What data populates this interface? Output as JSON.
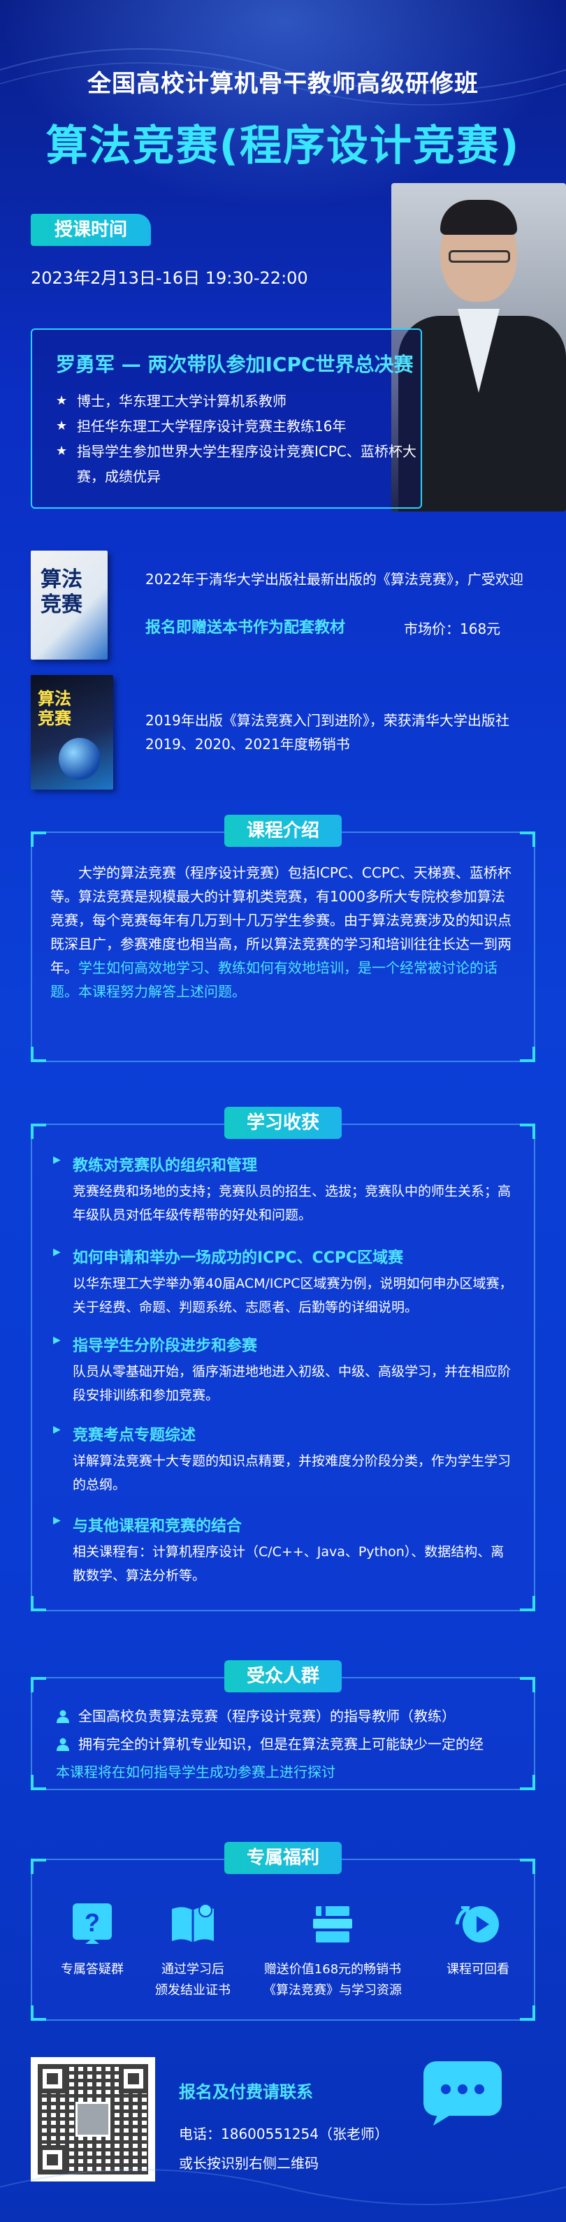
{
  "header": {
    "subtitle": "全国高校计算机骨干教师高级研修班",
    "title": "算法竞赛(程序设计竞赛)"
  },
  "schedule": {
    "tag": "授课时间",
    "time": "2023年2月13日-16日   19:30-22:00"
  },
  "teacher": {
    "name": "罗勇军 — 两次带队参加ICPC世界总决赛",
    "bullets": [
      "博士，华东理工大学计算机系教师",
      "担任华东理工大学程序设计竞赛主教练16年",
      "指导学生参加世界大学生程序设计竞赛ICPC、蓝桥杯大赛，成绩优异"
    ]
  },
  "books": [
    {
      "cover_text": "算法\n竞赛",
      "desc": "2022年于清华大学出版社最新出版的《算法竞赛》，广受欢迎",
      "promo": "报名即赠送本书作为配套教材",
      "price": "市场价：168元"
    },
    {
      "cover_text": "算法\n竞赛",
      "desc": "2019年出版《算法竞赛入门到进阶》，荣获清华大学出版社2019、2020、2021年度畅销书"
    }
  ],
  "intro": {
    "tag": "课程介绍",
    "text_plain": "大学的算法竞赛（程序设计竞赛）包括ICPC、CCPC、天梯赛、蓝桥杯等。算法竞赛是规模最大的计算机类竞赛，有1000多所大专院校参加算法竞赛，每个竞赛每年有几万到十几万学生参赛。由于算法竞赛涉及的知识点既深且广，参赛难度也相当高，所以算法竞赛的学习和培训往往长达一到两年。",
    "text_highlight": "学生如何高效地学习、教练如何有效地培训，是一个经常被讨论的话题。本课程努力解答上述问题。"
  },
  "gains": {
    "tag": "学习收获",
    "items": [
      {
        "title": "教练对竞赛队的组织和管理",
        "desc": "竞赛经费和场地的支持；竞赛队员的招生、选拔；竞赛队中的师生关系；高年级队员对低年级传帮带的好处和问题。"
      },
      {
        "title": "如何申请和举办一场成功的ICPC、CCPC区域赛",
        "desc": "以华东理工大学举办第40届ACM/ICPC区域赛为例，说明如何申办区域赛，关于经费、命题、判题系统、志愿者、后勤等的详细说明。"
      },
      {
        "title": "指导学生分阶段进步和参赛",
        "desc": "队员从零基础开始，循序渐进地地进入初级、中级、高级学习，并在相应阶段安排训练和参加竞赛。"
      },
      {
        "title": "竞赛考点专题综述",
        "desc": "详解算法竞赛十大专题的知识点精要，并按难度分阶段分类，作为学生学习的总纲。"
      },
      {
        "title": "与其他课程和竞赛的结合",
        "desc": "相关课程有：计算机程序设计（C/C++、Java、Python）、数据结构、离散数学、算法分析等。"
      }
    ]
  },
  "audience": {
    "tag": "受众人群",
    "rows": [
      "全国高校负责算法竞赛（程序设计竞赛）的指导教师（教练）",
      "拥有完全的计算机专业知识，但是在算法竞赛上可能缺少一定的经"
    ],
    "row2_cont": "本课程将在如何指导学生成功参赛上进行探讨"
  },
  "perks": {
    "tag": "专属福利",
    "items": [
      {
        "icon": "question-icon",
        "label": "专属答疑群"
      },
      {
        "icon": "book-icon",
        "label": "通过学习后\n颁发结业证书"
      },
      {
        "icon": "books-stack-icon",
        "label": "赠送价值168元的畅销书\n《算法竞赛》与学习资源"
      },
      {
        "icon": "playback-icon",
        "label": "课程可回看"
      }
    ]
  },
  "footer": {
    "title": "报名及付费请联系",
    "phone": "电话：18600551254（张老师）",
    "qr_hint": "或长按识别右侧二维码"
  },
  "colors": {
    "accent": "#4fe3ff",
    "tag_bg": "#14c8c8",
    "bg_top": "#0a1f8a",
    "bg_mid": "#0b3fd6"
  }
}
